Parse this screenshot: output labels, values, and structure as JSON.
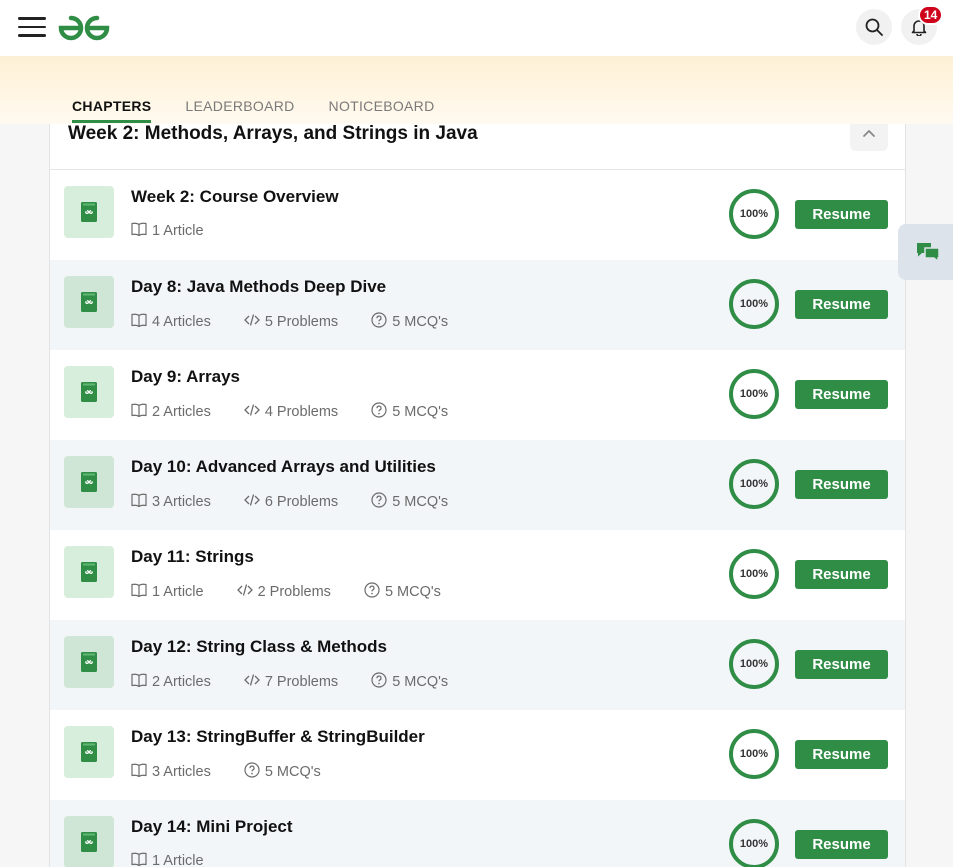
{
  "header": {
    "notification_count": "14"
  },
  "tabs": [
    {
      "label": "CHAPTERS",
      "active": true
    },
    {
      "label": "LEADERBOARD",
      "active": false
    },
    {
      "label": "NOTICEBOARD",
      "active": false
    }
  ],
  "week": {
    "title": "Week 2: Methods, Arrays, and Strings in Java"
  },
  "chapters": [
    {
      "title": "Week 2: Course Overview",
      "articles": "1 Article",
      "problems": "",
      "mcqs": "",
      "progress": "100%",
      "progress_value": 100,
      "action": "Resume"
    },
    {
      "title": "Day 8: Java Methods Deep Dive",
      "articles": "4 Articles",
      "problems": "5 Problems",
      "mcqs": "5 MCQ's",
      "progress": "100%",
      "progress_value": 100,
      "action": "Resume"
    },
    {
      "title": "Day 9: Arrays",
      "articles": "2 Articles",
      "problems": "4 Problems",
      "mcqs": "5 MCQ's",
      "progress": "100%",
      "progress_value": 100,
      "action": "Resume"
    },
    {
      "title": "Day 10: Advanced Arrays and Utilities",
      "articles": "3 Articles",
      "problems": "6 Problems",
      "mcqs": "5 MCQ's",
      "progress": "100%",
      "progress_value": 100,
      "action": "Resume"
    },
    {
      "title": "Day 11: Strings",
      "articles": "1 Article",
      "problems": "2 Problems",
      "mcqs": "5 MCQ's",
      "progress": "100%",
      "progress_value": 100,
      "action": "Resume"
    },
    {
      "title": "Day 12: String Class & Methods",
      "articles": "2 Articles",
      "problems": "7 Problems",
      "mcqs": "5 MCQ's",
      "progress": "100%",
      "progress_value": 100,
      "action": "Resume"
    },
    {
      "title": "Day 13: StringBuffer & StringBuilder",
      "articles": "3 Articles",
      "problems": "",
      "mcqs": "5 MCQ's",
      "progress": "100%",
      "progress_value": 100,
      "action": "Resume"
    },
    {
      "title": "Day 14: Mini Project",
      "articles": "1 Article",
      "problems": "",
      "mcqs": "",
      "progress": "100%",
      "progress_value": 100,
      "action": "Resume"
    }
  ],
  "icons": {
    "menu": "hamburger-menu-icon",
    "logo": "gfg-logo",
    "search": "search-icon",
    "notifications": "bell-icon",
    "collapse": "chevron-up-icon",
    "article": "book-icon",
    "problem": "code-icon",
    "mcq": "question-circle-icon",
    "chat": "chat-icon"
  },
  "colors": {
    "brand_green": "#2f8d46",
    "badge_red": "#d0021b",
    "row_alt_bg": "#f3f6f9"
  }
}
